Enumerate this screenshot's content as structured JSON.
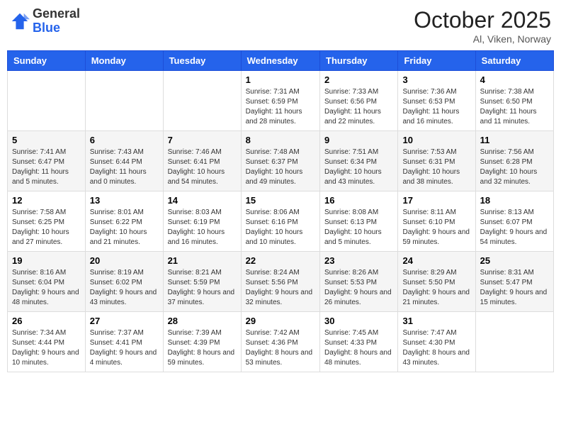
{
  "header": {
    "logo_general": "General",
    "logo_blue": "Blue",
    "month_title": "October 2025",
    "location": "Al, Viken, Norway"
  },
  "days_of_week": [
    "Sunday",
    "Monday",
    "Tuesday",
    "Wednesday",
    "Thursday",
    "Friday",
    "Saturday"
  ],
  "weeks": [
    [
      {
        "day": "",
        "info": ""
      },
      {
        "day": "",
        "info": ""
      },
      {
        "day": "",
        "info": ""
      },
      {
        "day": "1",
        "info": "Sunrise: 7:31 AM\nSunset: 6:59 PM\nDaylight: 11 hours and 28 minutes."
      },
      {
        "day": "2",
        "info": "Sunrise: 7:33 AM\nSunset: 6:56 PM\nDaylight: 11 hours and 22 minutes."
      },
      {
        "day": "3",
        "info": "Sunrise: 7:36 AM\nSunset: 6:53 PM\nDaylight: 11 hours and 16 minutes."
      },
      {
        "day": "4",
        "info": "Sunrise: 7:38 AM\nSunset: 6:50 PM\nDaylight: 11 hours and 11 minutes."
      }
    ],
    [
      {
        "day": "5",
        "info": "Sunrise: 7:41 AM\nSunset: 6:47 PM\nDaylight: 11 hours and 5 minutes."
      },
      {
        "day": "6",
        "info": "Sunrise: 7:43 AM\nSunset: 6:44 PM\nDaylight: 11 hours and 0 minutes."
      },
      {
        "day": "7",
        "info": "Sunrise: 7:46 AM\nSunset: 6:41 PM\nDaylight: 10 hours and 54 minutes."
      },
      {
        "day": "8",
        "info": "Sunrise: 7:48 AM\nSunset: 6:37 PM\nDaylight: 10 hours and 49 minutes."
      },
      {
        "day": "9",
        "info": "Sunrise: 7:51 AM\nSunset: 6:34 PM\nDaylight: 10 hours and 43 minutes."
      },
      {
        "day": "10",
        "info": "Sunrise: 7:53 AM\nSunset: 6:31 PM\nDaylight: 10 hours and 38 minutes."
      },
      {
        "day": "11",
        "info": "Sunrise: 7:56 AM\nSunset: 6:28 PM\nDaylight: 10 hours and 32 minutes."
      }
    ],
    [
      {
        "day": "12",
        "info": "Sunrise: 7:58 AM\nSunset: 6:25 PM\nDaylight: 10 hours and 27 minutes."
      },
      {
        "day": "13",
        "info": "Sunrise: 8:01 AM\nSunset: 6:22 PM\nDaylight: 10 hours and 21 minutes."
      },
      {
        "day": "14",
        "info": "Sunrise: 8:03 AM\nSunset: 6:19 PM\nDaylight: 10 hours and 16 minutes."
      },
      {
        "day": "15",
        "info": "Sunrise: 8:06 AM\nSunset: 6:16 PM\nDaylight: 10 hours and 10 minutes."
      },
      {
        "day": "16",
        "info": "Sunrise: 8:08 AM\nSunset: 6:13 PM\nDaylight: 10 hours and 5 minutes."
      },
      {
        "day": "17",
        "info": "Sunrise: 8:11 AM\nSunset: 6:10 PM\nDaylight: 9 hours and 59 minutes."
      },
      {
        "day": "18",
        "info": "Sunrise: 8:13 AM\nSunset: 6:07 PM\nDaylight: 9 hours and 54 minutes."
      }
    ],
    [
      {
        "day": "19",
        "info": "Sunrise: 8:16 AM\nSunset: 6:04 PM\nDaylight: 9 hours and 48 minutes."
      },
      {
        "day": "20",
        "info": "Sunrise: 8:19 AM\nSunset: 6:02 PM\nDaylight: 9 hours and 43 minutes."
      },
      {
        "day": "21",
        "info": "Sunrise: 8:21 AM\nSunset: 5:59 PM\nDaylight: 9 hours and 37 minutes."
      },
      {
        "day": "22",
        "info": "Sunrise: 8:24 AM\nSunset: 5:56 PM\nDaylight: 9 hours and 32 minutes."
      },
      {
        "day": "23",
        "info": "Sunrise: 8:26 AM\nSunset: 5:53 PM\nDaylight: 9 hours and 26 minutes."
      },
      {
        "day": "24",
        "info": "Sunrise: 8:29 AM\nSunset: 5:50 PM\nDaylight: 9 hours and 21 minutes."
      },
      {
        "day": "25",
        "info": "Sunrise: 8:31 AM\nSunset: 5:47 PM\nDaylight: 9 hours and 15 minutes."
      }
    ],
    [
      {
        "day": "26",
        "info": "Sunrise: 7:34 AM\nSunset: 4:44 PM\nDaylight: 9 hours and 10 minutes."
      },
      {
        "day": "27",
        "info": "Sunrise: 7:37 AM\nSunset: 4:41 PM\nDaylight: 9 hours and 4 minutes."
      },
      {
        "day": "28",
        "info": "Sunrise: 7:39 AM\nSunset: 4:39 PM\nDaylight: 8 hours and 59 minutes."
      },
      {
        "day": "29",
        "info": "Sunrise: 7:42 AM\nSunset: 4:36 PM\nDaylight: 8 hours and 53 minutes."
      },
      {
        "day": "30",
        "info": "Sunrise: 7:45 AM\nSunset: 4:33 PM\nDaylight: 8 hours and 48 minutes."
      },
      {
        "day": "31",
        "info": "Sunrise: 7:47 AM\nSunset: 4:30 PM\nDaylight: 8 hours and 43 minutes."
      },
      {
        "day": "",
        "info": ""
      }
    ]
  ]
}
